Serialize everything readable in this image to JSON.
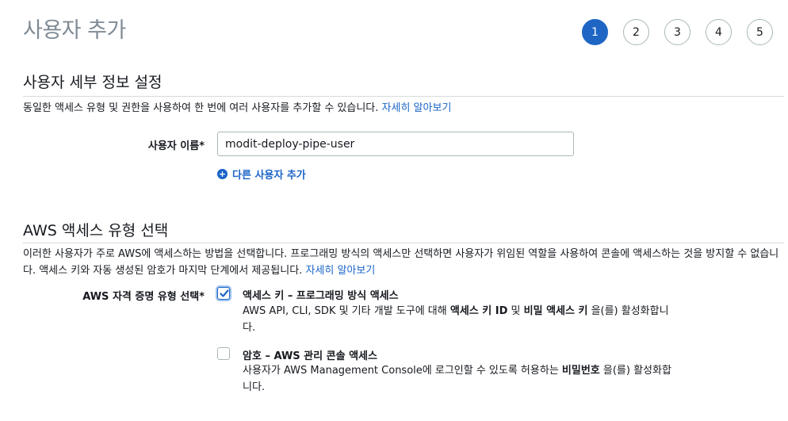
{
  "header": {
    "title": "사용자 추가",
    "steps": [
      "1",
      "2",
      "3",
      "4",
      "5"
    ],
    "active_step": "1",
    "accent_color": "#1f66c4"
  },
  "user_details": {
    "title": "사용자 세부 정보 설정",
    "description": "동일한 액세스 유형 및 권한을 사용하여 한 번에 여러 사용자를 추가할 수 있습니다.",
    "learn_more": "자세히 알아보기",
    "username_label": "사용자 이름*",
    "username_value": "modit-deploy-pipe-user",
    "add_user_label": "다른 사용자 추가",
    "add_user_icon": "plus-circle-icon"
  },
  "access_type": {
    "title": "AWS 액세스 유형 선택",
    "description": "이러한 사용자가 주로 AWS에 액세스하는 방법을 선택합니다. 프로그래밍 방식의 액세스만 선택하면 사용자가 위임된 역할을 사용하여 콘솔에 액세스하는 것을 방지할 수 없습니다. 액세스 키와 자동 생성된 암호가 마지막 단계에서 제공됩니다.",
    "learn_more": "자세히 알아보기",
    "credential_label": "AWS 자격 증명 유형 선택*",
    "options": [
      {
        "title": "액세스 키 – 프로그래밍 방식 액세스",
        "checked": true,
        "desc_pre": "AWS API, CLI, SDK 및 기타 개발 도구에 대해 ",
        "desc_b1": "액세스 키 ID",
        "desc_mid": " 및 ",
        "desc_b2": "비밀 액세스 키",
        "desc_post": " 을(를) 활성화합니다."
      },
      {
        "title": "암호 – AWS 관리 콘솔 액세스",
        "checked": false,
        "desc_pre": "사용자가 AWS Management Console에 로그인할 수 있도록 허용하는 ",
        "desc_b1": "비밀번호",
        "desc_post": " 을(를) 활성화합니다."
      }
    ]
  }
}
